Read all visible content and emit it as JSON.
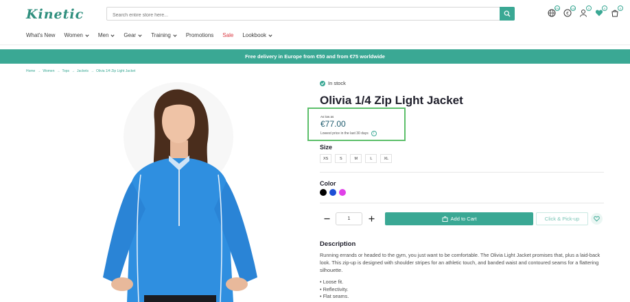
{
  "header": {
    "logo": "Kinetic",
    "search_placeholder": "Search entire store here...",
    "icons": [
      {
        "name": "globe-icon",
        "badge": "EN"
      },
      {
        "name": "currency-icon",
        "badge": "EUR"
      },
      {
        "name": "account-icon",
        "badge": "0"
      },
      {
        "name": "wishlist-heart-icon",
        "badge": "0"
      },
      {
        "name": "cart-icon",
        "badge": "0"
      }
    ]
  },
  "nav": {
    "items": [
      {
        "label": "What's New",
        "dropdown": false
      },
      {
        "label": "Women",
        "dropdown": true
      },
      {
        "label": "Men",
        "dropdown": true
      },
      {
        "label": "Gear",
        "dropdown": true
      },
      {
        "label": "Training",
        "dropdown": true
      },
      {
        "label": "Promotions",
        "dropdown": false
      },
      {
        "label": "Sale",
        "dropdown": false
      },
      {
        "label": "Lookbook",
        "dropdown": true
      }
    ]
  },
  "banner": {
    "text": "Free delivery in Europe from €50 and from €75 worldwide"
  },
  "breadcrumb": [
    "Home",
    "Women",
    "Tops",
    "Jackets",
    "Olivia 1/4 Zip Light Jacket"
  ],
  "product": {
    "stock": "In stock",
    "title": "Olivia 1/4 Zip Light Jacket",
    "as_low_as": "As low as",
    "price": "€77.00",
    "lowest_note": "Lowest price in the last 30 days",
    "info_icon": "i",
    "size_label": "Size",
    "sizes": [
      "XS",
      "S",
      "M",
      "L",
      "XL"
    ],
    "color_label": "Color",
    "colors": [
      "#000000",
      "#1d4fd6",
      "#e040e8"
    ],
    "qty": "1",
    "add_to_cart": "Add to Cart",
    "pickup": "Click & Pick-up",
    "description_title": "Description",
    "description": "Running errands or headed to the gym, you just want to be comfortable. The Olivia Light Jacket promises that, plus a laid-back look. This zip-up is designed with shoulder stripes for an athletic touch, and banded waist and contoured seams for a flattering silhouette.",
    "bullets": [
      "• Loose fit.",
      "• Reflectivity.",
      "• Flat seams."
    ]
  },
  "colors": {
    "accent": "#3aa894",
    "sale": "#d9363e",
    "highlight": "#5cbf6a",
    "jacket": "#2f8fe0"
  }
}
